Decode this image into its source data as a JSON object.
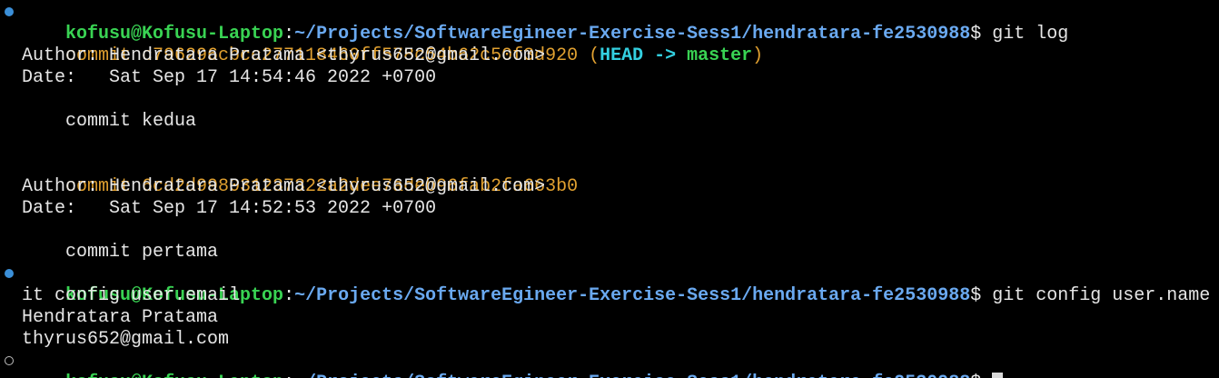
{
  "prompt": {
    "user_host": "kofusu@Kofusu-Laptop",
    "separator": ":",
    "path": "~/Projects/SoftwareEgineer-Exercise-Sess1/hendratara-fe2530988",
    "symbol": "$"
  },
  "commands": {
    "first": " git log",
    "second": " git config user.name &&g",
    "second_wrap": "it config user.email",
    "third": " "
  },
  "log": {
    "commit1": {
      "label": "commit c796296cbcc277118460ff578c54b62c50f3d920",
      "ref_open": " (",
      "head": "HEAD ->",
      "branch": "master",
      "ref_close": ")",
      "author": "Author: Hendratara Pratama <thyrus652@gmail.com>",
      "date": "Date:   Sat Sep 17 14:54:46 2022 +0700",
      "message": "    commit kedua"
    },
    "commit2": {
      "label": "commit 6cd2d998031237322a2dee7adeb96fab2fa663b0",
      "author": "Author: Hendratara Pratama <thyrus652@gmail.com>",
      "date": "Date:   Sat Sep 17 14:52:53 2022 +0700",
      "message": "    commit pertama"
    }
  },
  "output": {
    "user_name": "Hendratara Pratama",
    "user_email": "thyrus652@gmail.com"
  },
  "colors": {
    "background": "#000000",
    "user_host": "#39d353",
    "path": "#6aa9f0",
    "commit_hash": "#e0a030",
    "head_ref": "#33d0e0",
    "branch_ref": "#39d353",
    "dot_success": "#3b8fd8"
  },
  "icons": {
    "first_prompt": "command-status-dot-icon",
    "second_prompt": "command-status-dot-icon",
    "third_prompt": "command-pending-circle-icon"
  }
}
